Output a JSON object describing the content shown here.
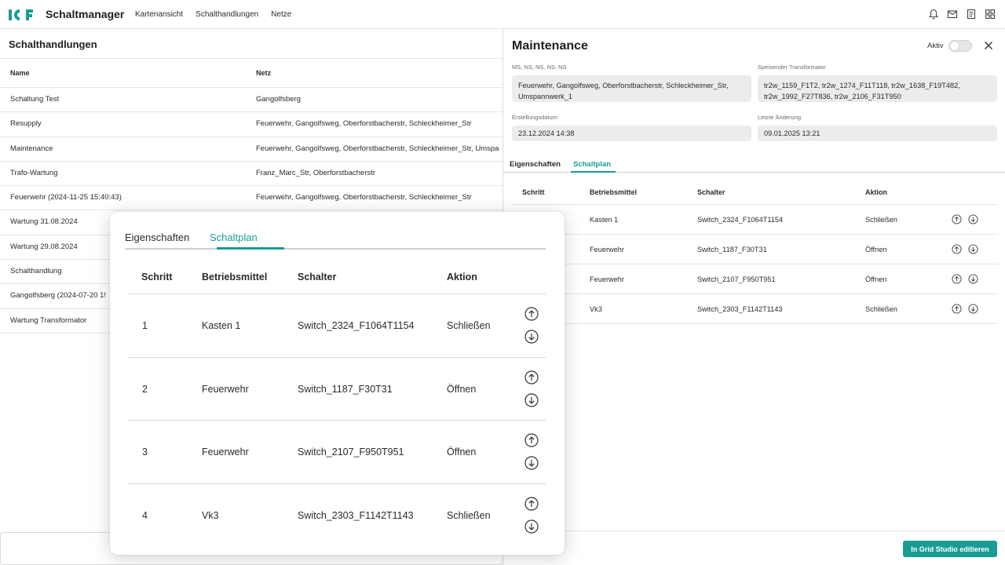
{
  "app": {
    "title": "Schaltmanager",
    "brand_color": "#1a9c95"
  },
  "nav": [
    "Kartenansicht",
    "Schalthandlungen",
    "Netze"
  ],
  "top_icons": [
    "bell-icon",
    "mail-icon",
    "document-icon",
    "grid-icon"
  ],
  "list": {
    "title": "Schalthandlungen",
    "columns": [
      "Name",
      "Netz"
    ],
    "rows": [
      {
        "name": "Schaltung Test",
        "netz": "Gangolfsberg"
      },
      {
        "name": "Resupply",
        "netz": "Feuerwehr, Gangolfsweg, Oberforstbacherstr, Schleckheimer_Str"
      },
      {
        "name": "Maintenance",
        "netz": "Feuerwehr, Gangolfsweg, Oberforstbacherstr, Schleckheimer_Str, Umspa"
      },
      {
        "name": "Trafo-Wartung",
        "netz": "Franz_Marc_Str, Oberforstbacherstr"
      },
      {
        "name": "Feuerwehr (2024-11-25 15:40:43)",
        "netz": "Feuerwehr, Gangolfsweg, Oberforstbacherstr, Schleckheimer_Str"
      },
      {
        "name": "Wartung 31.08.2024",
        "netz": ""
      },
      {
        "name": "Wartung 29.08.2024",
        "netz": ""
      },
      {
        "name": "Schalthandlung",
        "netz": ""
      },
      {
        "name": "Gangolfsberg (2024-07-20 1!",
        "netz": ""
      },
      {
        "name": "Wartung Transformator",
        "netz": ""
      }
    ]
  },
  "detail": {
    "title": "Maintenance",
    "aktiv_label": "Aktiv",
    "aktiv_value": false,
    "netz_label": "MS, NS, NS, NS, NS",
    "netz_value": "Feuerwehr, Gangolfsweg, Oberforstbacherstr, Schleckheimer_Str, Umspannwerk_1",
    "trafo_label": "Speisender Transformator",
    "trafo_value": "tr2w_1159_F1T2, tr2w_1274_F11T118, tr2w_1638_F19T482, tr2w_1992_F27T836, tr2w_2106_F31T950",
    "created_label": "Erstellungsdatum",
    "created_value": "23.12.2024 14:38",
    "changed_label": "Letzte Änderung",
    "changed_value": "09.01.2025 13:21",
    "tabs": [
      "Eigenschaften",
      "Schaltplan"
    ],
    "active_tab": "Schaltplan",
    "columns": [
      "Schritt",
      "Betriebsmittel",
      "Schalter",
      "Aktion"
    ],
    "steps": [
      {
        "schritt": "1",
        "betriebsmittel": "Kasten 1",
        "schalter": "Switch_2324_F1064T1154",
        "aktion": "Schließen"
      },
      {
        "schritt": "2",
        "betriebsmittel": "Feuerwehr",
        "schalter": "Switch_1187_F30T31",
        "aktion": "Öffnen"
      },
      {
        "schritt": "3",
        "betriebsmittel": "Feuerwehr",
        "schalter": "Switch_2107_F950T951",
        "aktion": "Öffnen"
      },
      {
        "schritt": "4",
        "betriebsmittel": "Vk3",
        "schalter": "Switch_2303_F1142T1143",
        "aktion": "Schließen"
      }
    ],
    "edit_button": "In Grid Studio editieren"
  }
}
